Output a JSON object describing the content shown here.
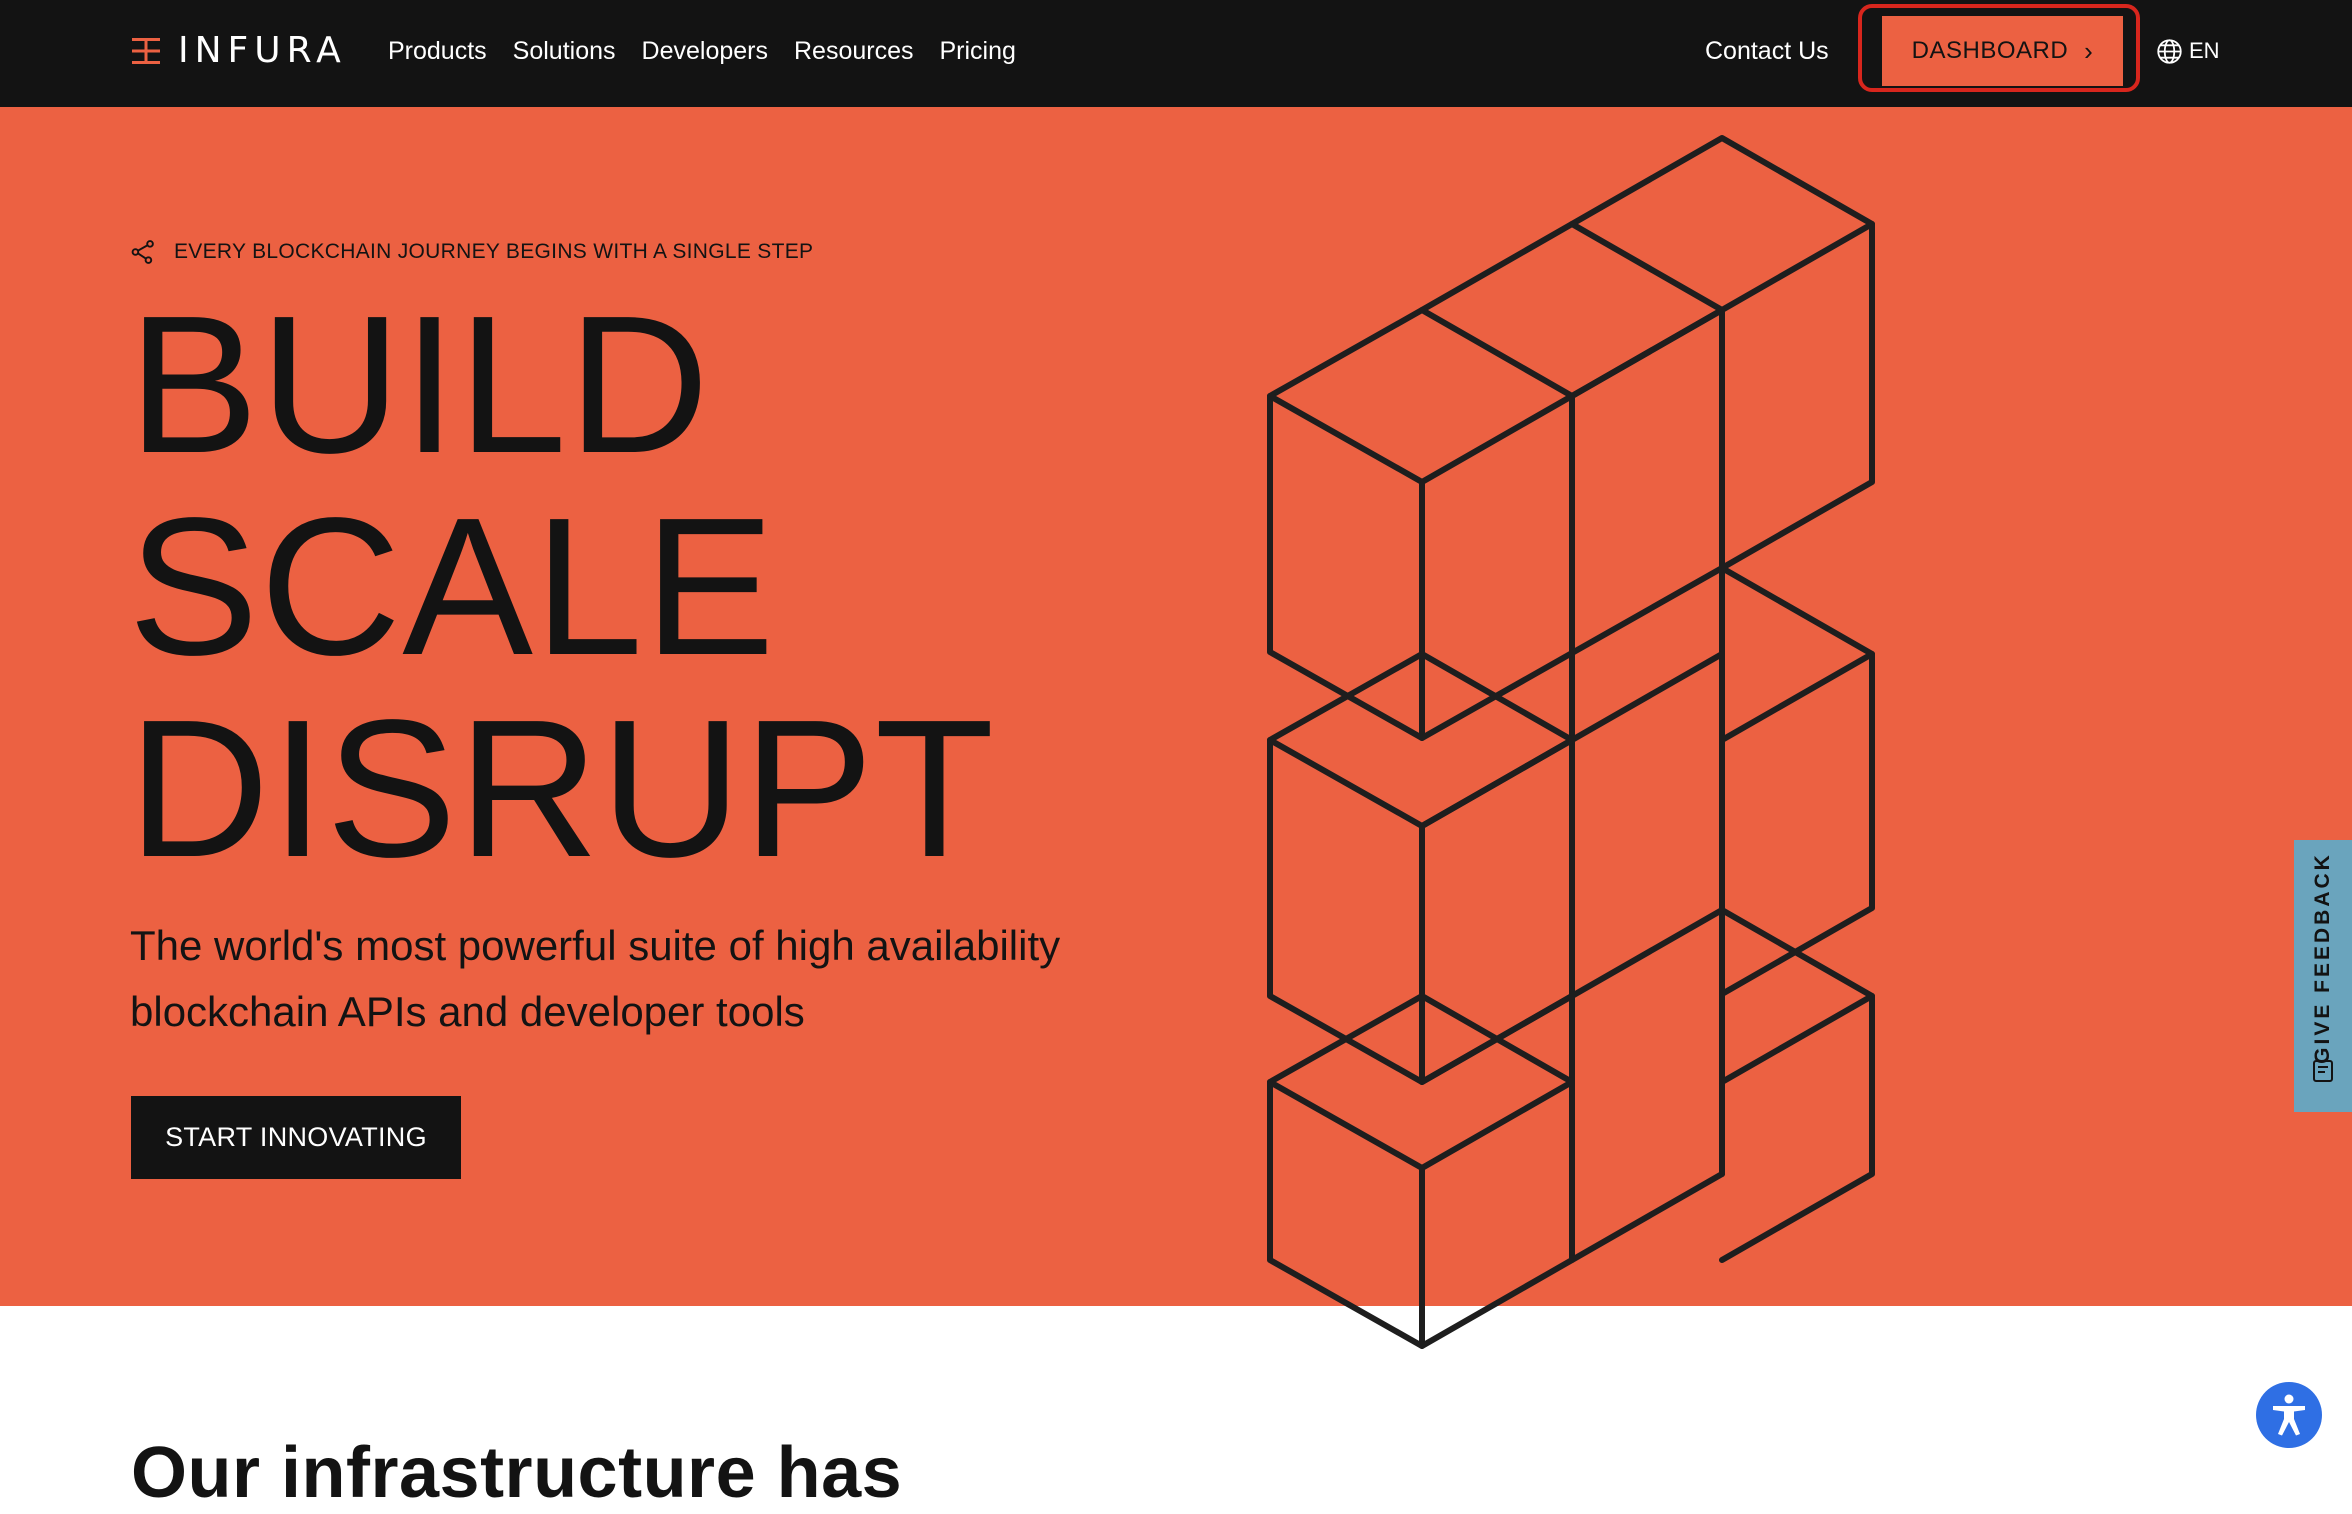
{
  "nav": {
    "brand": "INFURA",
    "links": [
      {
        "label": "Products"
      },
      {
        "label": "Solutions"
      },
      {
        "label": "Developers"
      },
      {
        "label": "Resources"
      },
      {
        "label": "Pricing"
      }
    ],
    "contact_label": "Contact Us",
    "dashboard_label": "DASHBOARD",
    "dashboard_chevron": "›",
    "language": "EN"
  },
  "hero": {
    "eyebrow": "EVERY BLOCKCHAIN JOURNEY BEGINS WITH A SINGLE STEP",
    "headline_lines": [
      "BUILD",
      "SCALE",
      "DISRUPT"
    ],
    "subtext": "The world's most powerful suite of high availability blockchain APIs and developer tools",
    "cta_label": "START INNOVATING"
  },
  "feedback": {
    "label": "GIVE FEEDBACK"
  },
  "section": {
    "heading": "Our infrastructure has"
  },
  "icons": {
    "logo": "infura-logo-icon",
    "globe": "globe-icon",
    "eyebrow": "share-nodes-icon",
    "feedback": "feedback-note-icon",
    "accessibility": "accessibility-icon",
    "illustration": "isometric-cubes-illustration"
  },
  "colors": {
    "brand_orange": "#ec6142",
    "nav_background": "#131313",
    "text_dark": "#131313",
    "highlight_red": "#d8261d",
    "feedback_tab": "#6aa4bd",
    "accessibility_blue": "#2f6fe4"
  }
}
